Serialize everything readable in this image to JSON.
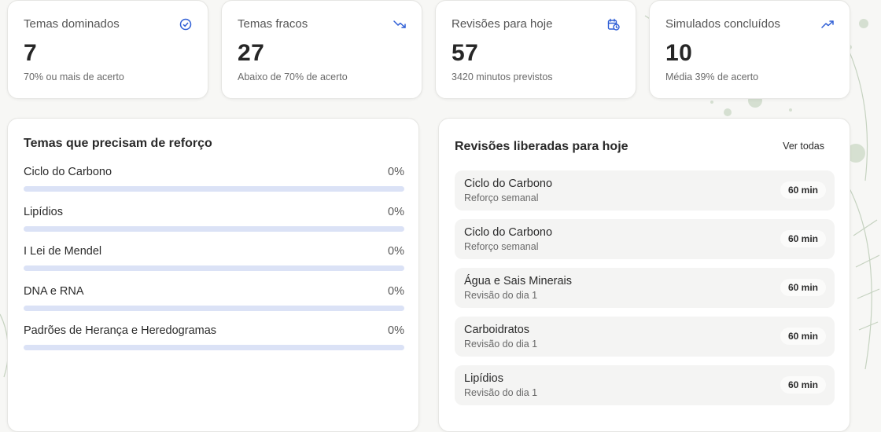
{
  "stats": [
    {
      "title": "Temas dominados",
      "value": "7",
      "sub": "70% ou mais de acerto",
      "icon": "check-circle-icon"
    },
    {
      "title": "Temas fracos",
      "value": "27",
      "sub": "Abaixo de 70% de acerto",
      "icon": "trending-down-icon"
    },
    {
      "title": "Revisões para hoje",
      "value": "57",
      "sub": "3420 minutos previstos",
      "icon": "calendar-clock-icon"
    },
    {
      "title": "Simulados concluídos",
      "value": "10",
      "sub": "Média 39% de acerto",
      "icon": "trending-up-icon"
    }
  ],
  "weak_topics": {
    "title": "Temas que precisam de reforço",
    "items": [
      {
        "name": "Ciclo do Carbono",
        "pct": "0%",
        "progress": 0
      },
      {
        "name": "Lipídios",
        "pct": "0%",
        "progress": 0
      },
      {
        "name": "I Lei de Mendel",
        "pct": "0%",
        "progress": 0
      },
      {
        "name": "DNA e RNA",
        "pct": "0%",
        "progress": 0
      },
      {
        "name": "Padrões de Herança e Heredogramas",
        "pct": "0%",
        "progress": 0
      }
    ]
  },
  "reviews": {
    "title": "Revisões liberadas para hoje",
    "see_all": "Ver todas",
    "items": [
      {
        "name": "Ciclo do Carbono",
        "sub": "Reforço semanal",
        "duration": "60 min"
      },
      {
        "name": "Ciclo do Carbono",
        "sub": "Reforço semanal",
        "duration": "60 min"
      },
      {
        "name": "Água e Sais Minerais",
        "sub": "Revisão do dia 1",
        "duration": "60 min"
      },
      {
        "name": "Carboidratos",
        "sub": "Revisão do dia 1",
        "duration": "60 min"
      },
      {
        "name": "Lipídios",
        "sub": "Revisão do dia 1",
        "duration": "60 min"
      }
    ]
  },
  "colors": {
    "accent": "#2f5fd6",
    "bar_track": "#dbe2f6",
    "background": "#f7f7f5"
  }
}
